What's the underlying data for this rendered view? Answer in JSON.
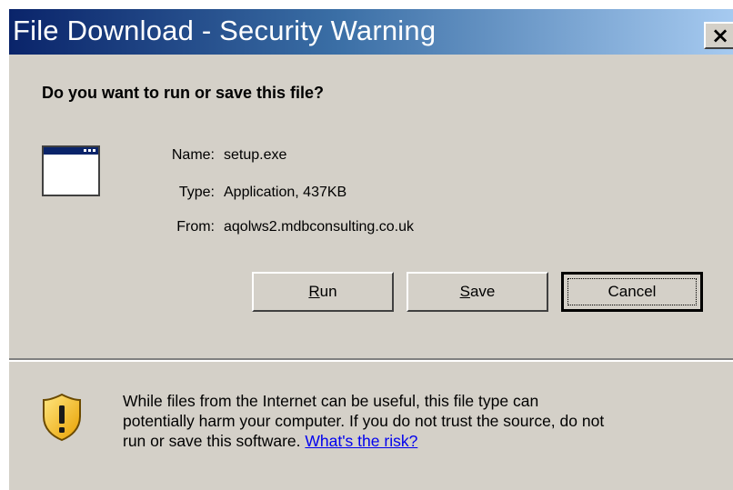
{
  "window": {
    "title": "File Download - Security Warning",
    "close_label": "×"
  },
  "prompt": {
    "heading": "Do you want to run or save this file?"
  },
  "file": {
    "name_label": "Name:",
    "name_value": "setup.exe",
    "type_label": "Type:",
    "type_value": "Application, 437KB",
    "from_label": "From:",
    "from_value": "aqolws2.mdbconsulting.co.uk",
    "icon": "application-window-icon"
  },
  "buttons": {
    "run_first": "R",
    "run_rest": "un",
    "save_first": "S",
    "save_rest": "ave",
    "cancel": "Cancel"
  },
  "warning": {
    "icon": "shield-warning-icon",
    "line1": "While files from the Internet can be useful, this file type can",
    "line2": "potentially harm your computer. If you do not trust the source, do not",
    "line3_text": "run or save this software. ",
    "link": "What's the risk?"
  },
  "colors": {
    "titlebar_start": "#0a246a",
    "titlebar_end": "#a6caf0",
    "dialog_face": "#d4d0c8",
    "link": "#0000ee"
  }
}
